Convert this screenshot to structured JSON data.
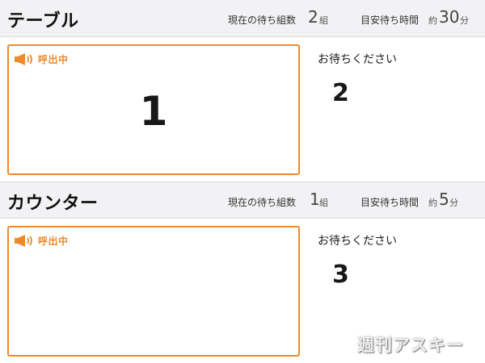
{
  "common": {
    "wait_groups_label": "現在の待ち組数",
    "groups_unit": "組",
    "est_wait_label": "目安待ち時間",
    "approx_label": "約",
    "minutes_unit": "分",
    "calling_label": "呼出中",
    "waiting_label": "お待ちください",
    "accent_color": "#ee8a2a"
  },
  "sections": [
    {
      "title": "テーブル",
      "wait_groups": "2",
      "est_wait_minutes": "30",
      "calling_number": "1",
      "waiting_numbers": [
        "2"
      ]
    },
    {
      "title": "カウンター",
      "wait_groups": "1",
      "est_wait_minutes": "5",
      "calling_number": "",
      "waiting_numbers": [
        "3"
      ]
    }
  ],
  "watermark": "週刊アスキー"
}
